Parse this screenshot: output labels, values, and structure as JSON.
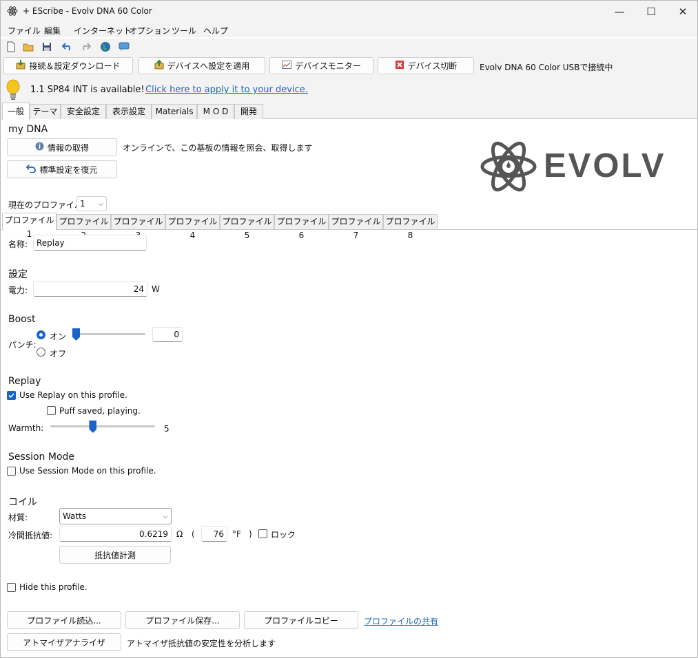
{
  "window": {
    "title": "+ EScribe - Evolv DNA 60 Color",
    "minimize": "—",
    "maximize": "☐",
    "close": "✕"
  },
  "menu": [
    "ファイル",
    "編集",
    "インターネット",
    "オプション",
    "ツール",
    "ヘルプ"
  ],
  "actions": {
    "connect": "接続＆設定ダウンロード",
    "apply": "デバイスへ設定を適用",
    "monitor": "デバイスモニター",
    "disconnect": "デバイス切断",
    "status": "Evolv DNA 60 Color USBで接続中"
  },
  "notice": {
    "text": "1.1 SP84 INT is available!",
    "link": "Click here to apply it to your device."
  },
  "tabs": [
    "一般",
    "テーマ",
    "安全設定",
    "表示設定",
    "Materials",
    "M O D",
    "開発"
  ],
  "mydna": {
    "heading": "my DNA",
    "info_button": "情報の取得",
    "info_desc": "オンラインで、この基板の情報を照会、取得します",
    "restore_button": "標準設定を復元",
    "logo_text": "EVOLV"
  },
  "profile_select": {
    "label": "現在のプロファイル:",
    "value": "1"
  },
  "profile_tabs": [
    "プロファイル 1",
    "プロファイル 2",
    "プロファイル 3",
    "プロファイル 4",
    "プロファイル 5",
    "プロファイル 6",
    "プロファイル 7",
    "プロファイル 8"
  ],
  "name": {
    "label": "名称:",
    "value": "Replay"
  },
  "settings": {
    "heading": "設定",
    "power_label": "電力:",
    "power_value": "24",
    "power_unit": "W"
  },
  "boost": {
    "heading": "Boost",
    "punch_label": "パンチ:",
    "on_label": "オン",
    "off_label": "オフ",
    "value": "0",
    "level": 0
  },
  "replay": {
    "heading": "Replay",
    "use_label": "Use Replay on this profile.",
    "use_checked": true,
    "puff_label": "Puff saved, playing.",
    "puff_checked": false,
    "warmth_label": "Warmth:",
    "warmth_value": "5",
    "warmth_level": 0.4
  },
  "session": {
    "heading": "Session Mode",
    "use_label": "Use Session Mode on this profile.",
    "checked": false
  },
  "coil": {
    "heading": "コイル",
    "material_label": "材質:",
    "material_value": "Watts",
    "cold_label": "冷間抵抗値:",
    "cold_value": "0.6219",
    "ohm": "Ω",
    "paren_open": "(",
    "temp_value": "76",
    "temp_unit": "°F",
    "paren_close": ")",
    "lock_label": "ロック",
    "measure_button": "抵抗値計測"
  },
  "hide_label": "Hide this profile.",
  "bottom": {
    "load": "プロファイル読込...",
    "save": "プロファイル保存...",
    "copy": "プロファイルコピー",
    "share": "プロファイルの共有",
    "analyzer": "アトマイザアナライザ",
    "analyzer_desc": "アトマイザ抵抗値の安定性を分析します"
  },
  "colors": {
    "accent": "#1a64c8",
    "logo": "#555555"
  }
}
